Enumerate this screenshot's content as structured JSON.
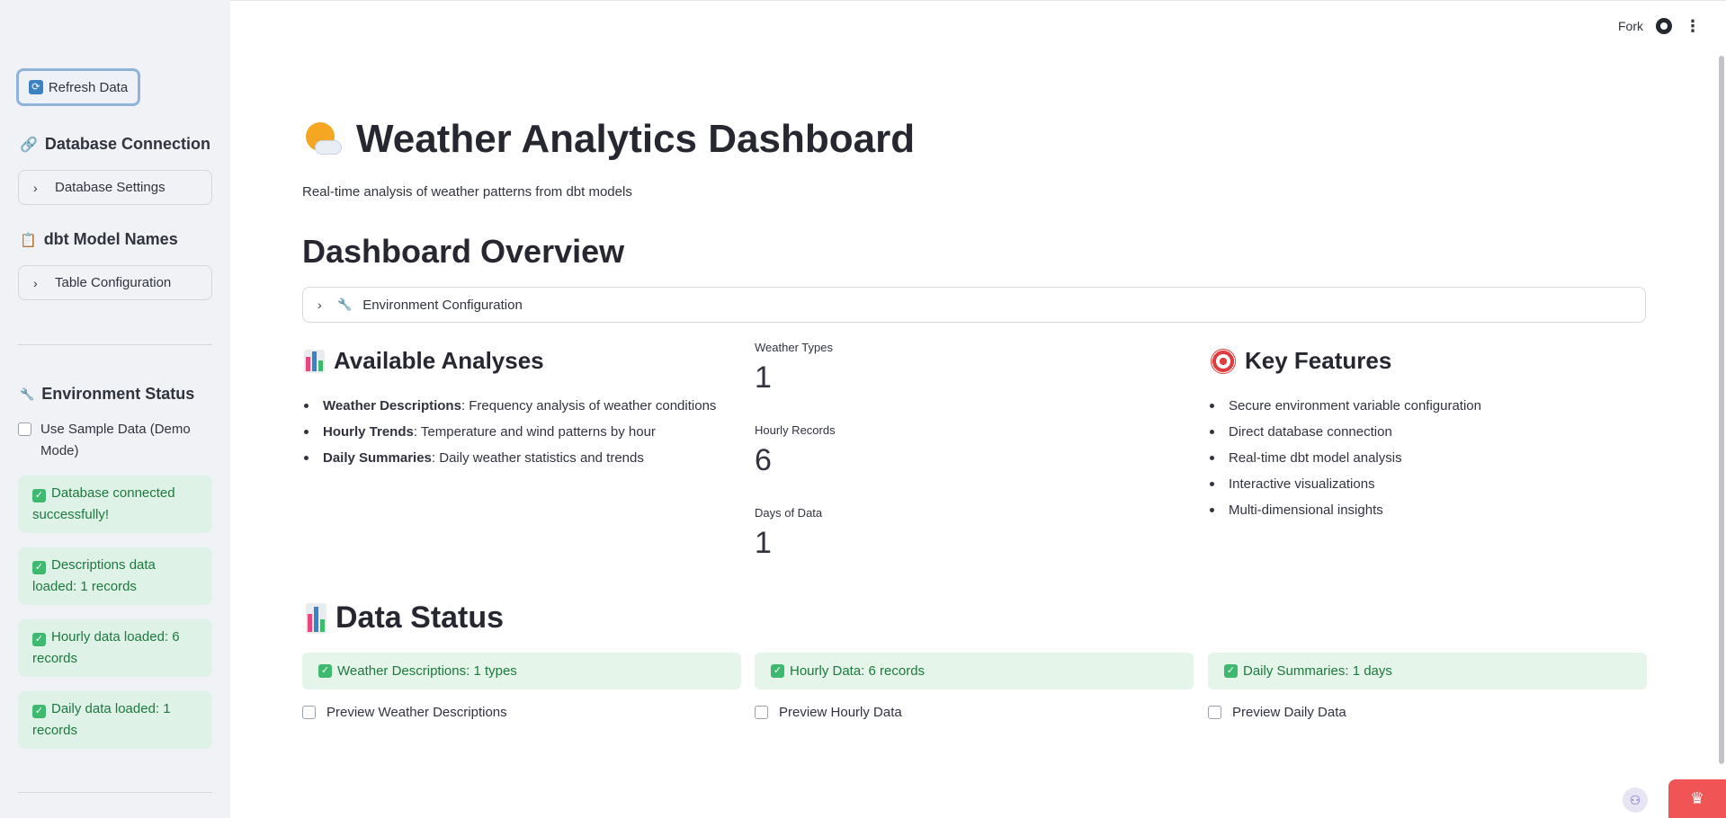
{
  "toolbar": {
    "fork_label": "Fork",
    "github_icon": "github-icon",
    "menu_icon": "kebab-menu-icon"
  },
  "sidebar": {
    "refresh_label": "Refresh Data",
    "db_heading": "Database Connection",
    "db_expander": "Database Settings",
    "dbt_heading": "dbt Model Names",
    "dbt_expander": "Table Configuration",
    "env_heading": "Environment Status",
    "sample_checkbox": "Use Sample Data (Demo Mode)",
    "messages": [
      "Database connected successfully!",
      "Descriptions data loaded: 1 records",
      "Hourly data loaded: 6 records",
      "Daily data loaded: 1 records"
    ]
  },
  "main": {
    "title": "Weather Analytics Dashboard",
    "subtitle": "Real-time analysis of weather patterns from dbt models",
    "overview_heading": "Dashboard Overview",
    "env_expander": "Environment Configuration",
    "analyses": {
      "heading": "Available Analyses",
      "items": [
        {
          "bold": "Weather Descriptions",
          "text": ": Frequency analysis of weather conditions"
        },
        {
          "bold": "Hourly Trends",
          "text": ": Temperature and wind patterns by hour"
        },
        {
          "bold": "Daily Summaries",
          "text": ": Daily weather statistics and trends"
        }
      ]
    },
    "metrics": [
      {
        "label": "Weather Types",
        "value": "1"
      },
      {
        "label": "Hourly Records",
        "value": "6"
      },
      {
        "label": "Days of Data",
        "value": "1"
      }
    ],
    "features": {
      "heading": "Key Features",
      "items": [
        "Secure environment variable configuration",
        "Direct database connection",
        "Real-time dbt model analysis",
        "Interactive visualizations",
        "Multi-dimensional insights"
      ]
    },
    "data_status": {
      "heading": "Data Status",
      "boxes": [
        "Weather Descriptions: 1 types",
        "Hourly Data: 6 records",
        "Daily Summaries: 1 days"
      ],
      "previews": [
        "Preview Weather Descriptions",
        "Preview Hourly Data",
        "Preview Daily Data"
      ]
    }
  },
  "colors": {
    "sidebar_bg": "#f0f2f6",
    "success_bg": "#dff2e7",
    "success_text": "#1b7a3d",
    "accent_red": "#f05454"
  }
}
